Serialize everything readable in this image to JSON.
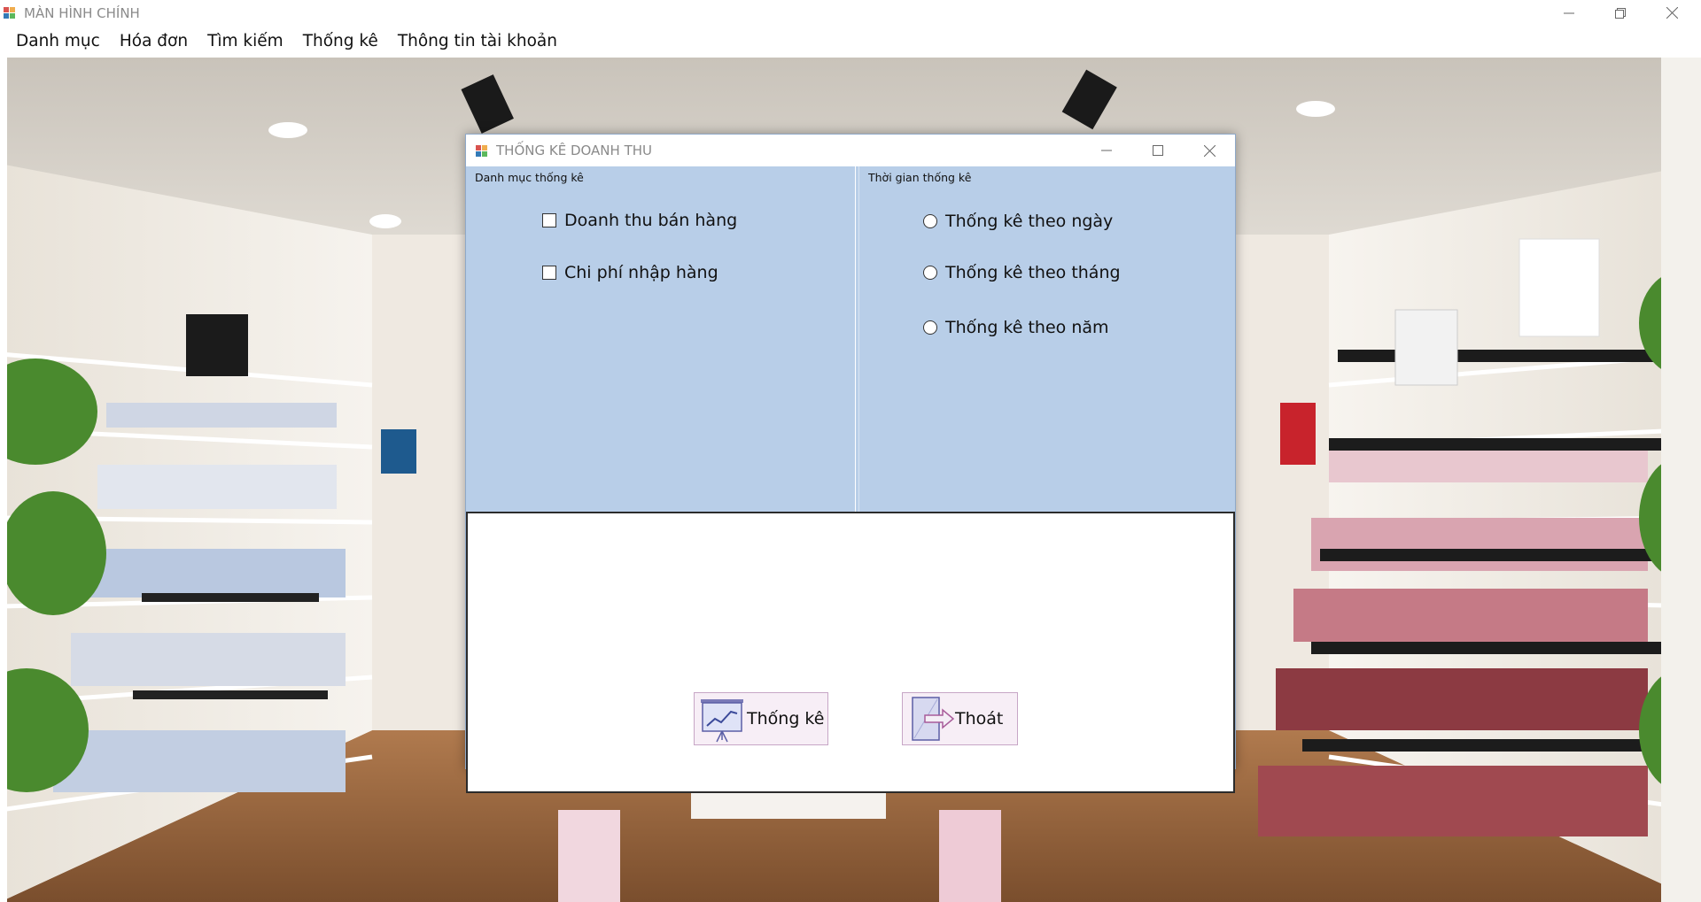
{
  "window": {
    "title": "MÀN HÌNH CHÍNH",
    "controls": [
      "minimize",
      "restore",
      "close"
    ]
  },
  "menubar": {
    "items": [
      "Danh mục",
      "Hóa đơn",
      "Tìm kiếm",
      "Thống kê",
      "Thông tin tài khoản"
    ]
  },
  "dialog": {
    "title": "THỐNG KÊ DOANH THU",
    "category_group": {
      "label": "Danh mục thống kê",
      "options": [
        "Doanh thu bán hàng",
        "Chi phí nhập hàng"
      ]
    },
    "time_group": {
      "label": "Thời gian thống kê",
      "options": [
        "Thống kê theo ngày",
        "Thống kê theo tháng",
        "Thống kê theo năm"
      ]
    },
    "buttons": {
      "stats_label": "Thống kê",
      "exit_label": "Thoát"
    },
    "colors": {
      "background": "#b8cee8",
      "button_bg": "#f7eef6"
    }
  }
}
